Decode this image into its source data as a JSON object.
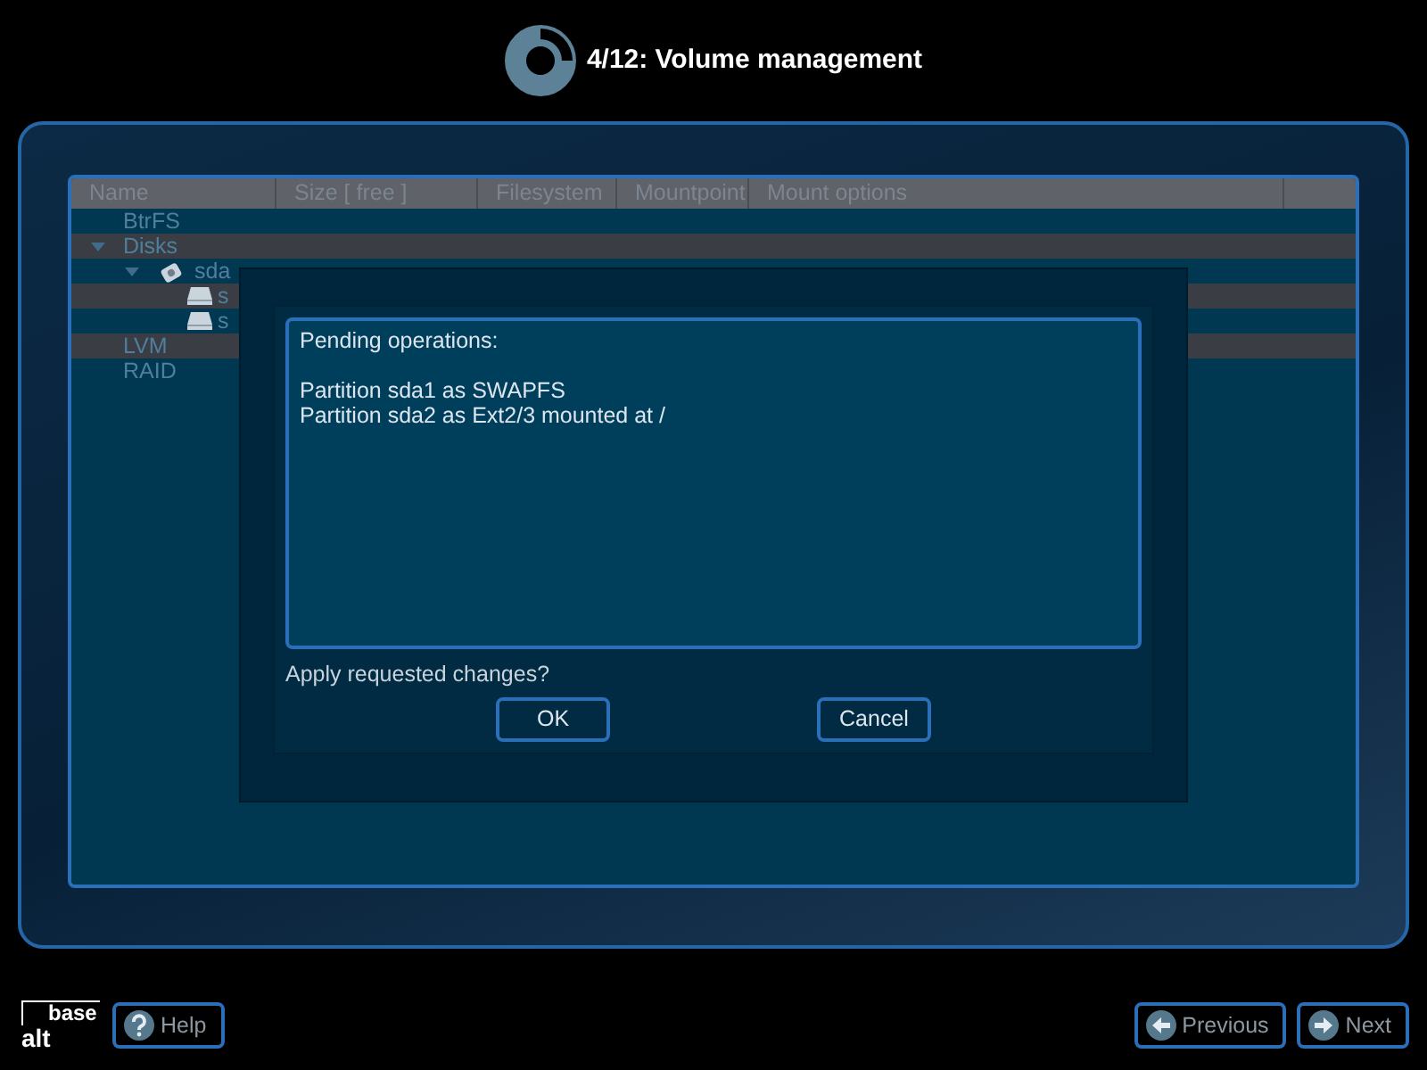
{
  "header": {
    "title": "4/12: Volume management"
  },
  "table": {
    "columns": [
      "Name",
      "Size [ free ]",
      "Filesystem",
      "Mountpoint",
      "Mount options"
    ],
    "rows": [
      {
        "name": "BtrFS"
      },
      {
        "name": "Disks",
        "expanded": true,
        "children": [
          {
            "name": "sda",
            "kind": "disk",
            "expanded": true,
            "children": [
              {
                "name": "s",
                "kind": "partition"
              },
              {
                "name": "s",
                "kind": "partition"
              }
            ]
          }
        ]
      },
      {
        "name": "LVM"
      },
      {
        "name": "RAID"
      }
    ]
  },
  "dialog": {
    "log_title": "Pending operations:",
    "log_lines": [
      "Partition sda1 as SWAPFS",
      "Partition sda2 as Ext2/3 mounted at /"
    ],
    "question": "Apply requested changes?",
    "buttons": [
      "OK",
      "Cancel"
    ]
  },
  "footer": {
    "logo": [
      "base",
      "alt"
    ],
    "help": "Help",
    "previous": "Previous",
    "next": "Next"
  }
}
